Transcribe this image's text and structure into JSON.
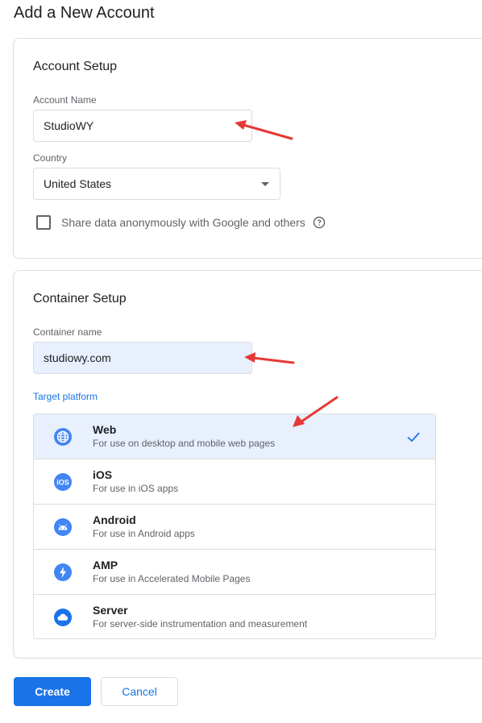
{
  "page": {
    "title": "Add a New Account"
  },
  "account_setup": {
    "title": "Account Setup",
    "account_name_label": "Account Name",
    "account_name_value": "StudioWY",
    "country_label": "Country",
    "country_value": "United States",
    "share_label": "Share data anonymously with Google and others",
    "share_checked": false
  },
  "container_setup": {
    "title": "Container Setup",
    "container_name_label": "Container name",
    "container_name_value": "studiowy.com",
    "target_platform_label": "Target platform",
    "platforms": [
      {
        "name": "Web",
        "description": "For use on desktop and mobile web pages",
        "icon": "globe-icon",
        "selected": true
      },
      {
        "name": "iOS",
        "description": "For use in iOS apps",
        "icon": "ios-icon",
        "selected": false
      },
      {
        "name": "Android",
        "description": "For use in Android apps",
        "icon": "android-icon",
        "selected": false
      },
      {
        "name": "AMP",
        "description": "For use in Accelerated Mobile Pages",
        "icon": "amp-icon",
        "selected": false
      },
      {
        "name": "Server",
        "description": "For server-side instrumentation and measurement",
        "icon": "cloud-icon",
        "selected": false
      }
    ]
  },
  "actions": {
    "create_label": "Create",
    "cancel_label": "Cancel"
  },
  "colors": {
    "accent": "#1a73e8",
    "selected_bg": "#e8f0fe",
    "annotation_arrow": "#e53935",
    "icon_blue": "#4285f4"
  }
}
